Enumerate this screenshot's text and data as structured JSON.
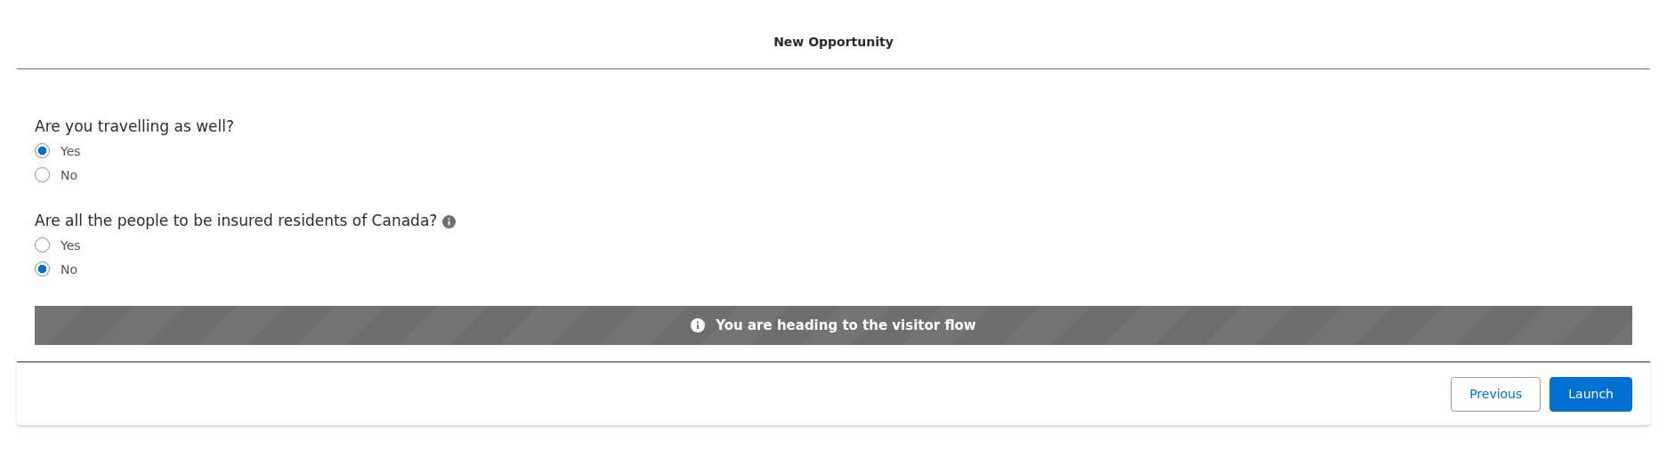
{
  "header": {
    "title": "New Opportunity"
  },
  "questions": [
    {
      "kind": "plain",
      "label": "Are you travelling as well?",
      "options": [
        {
          "label": "Yes",
          "selected": true
        },
        {
          "label": "No",
          "selected": false
        }
      ]
    },
    {
      "kind": "info",
      "label": "Are all the people to be insured residents of Canada?",
      "options": [
        {
          "label": "Yes",
          "selected": false
        },
        {
          "label": "No",
          "selected": true
        }
      ]
    }
  ],
  "banner": {
    "message": "You are heading to the visitor flow"
  },
  "footer": {
    "buttons": [
      {
        "label": "Previous",
        "kind": "neutral"
      },
      {
        "label": "Launch",
        "kind": "brand"
      }
    ]
  }
}
